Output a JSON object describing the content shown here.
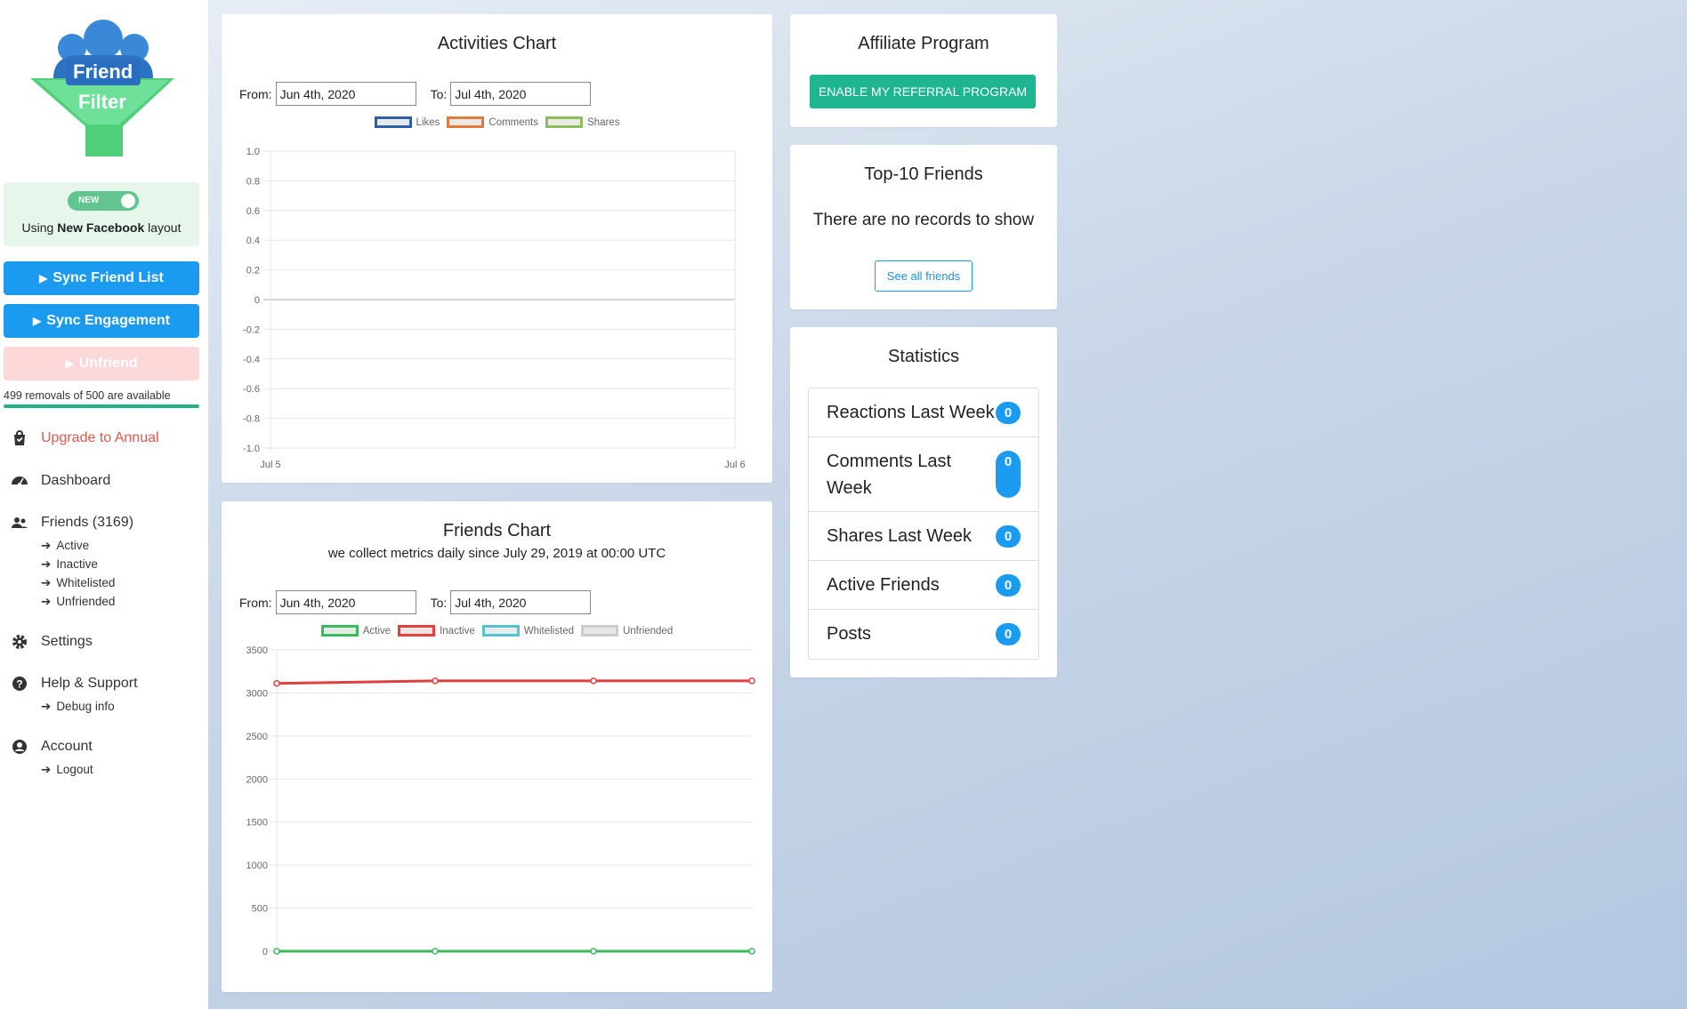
{
  "sidebar": {
    "logo": {
      "line1": "Friend",
      "line2": "Filter"
    },
    "layout": {
      "toggle_label": "NEW",
      "text_prefix": "Using ",
      "text_bold": "New Facebook",
      "text_suffix": " layout"
    },
    "buttons": [
      {
        "label": "Sync Friend List"
      },
      {
        "label": "Sync Engagement"
      },
      {
        "label": "Unfriend"
      }
    ],
    "removals_text": "499 removals of 500 are available",
    "removals_fraction": 0.998,
    "nav": {
      "upgrade": "Upgrade to Annual",
      "dashboard": "Dashboard",
      "friends": "Friends (3169)",
      "friends_sub": [
        "Active",
        "Inactive",
        "Whitelisted",
        "Unfriended"
      ],
      "settings": "Settings",
      "help": "Help & Support",
      "help_sub": [
        "Debug info"
      ],
      "account": "Account",
      "account_sub": [
        "Logout"
      ]
    },
    "arrow_glyph": "➔"
  },
  "activities": {
    "title": "Activities Chart",
    "from_label": "From:",
    "from_value": "Jun 4th, 2020",
    "to_label": "To:",
    "to_value": "Jul 4th, 2020"
  },
  "friends_chart": {
    "title": "Friends Chart",
    "subtitle": "we collect metrics daily since July 29, 2019 at 00:00 UTC",
    "from_label": "From:",
    "from_value": "Jun 4th, 2020",
    "to_label": "To:",
    "to_value": "Jul 4th, 2020"
  },
  "affiliate": {
    "title": "Affiliate Program",
    "button": "ENABLE MY REFERRAL PROGRAM"
  },
  "top10": {
    "title": "Top-10 Friends",
    "empty": "There are no records to show",
    "button": "See all friends"
  },
  "statistics": {
    "title": "Statistics",
    "rows": [
      {
        "label": "Reactions Last Week",
        "value": "0"
      },
      {
        "label": "Comments Last Week",
        "value": "0"
      },
      {
        "label": "Shares Last Week",
        "value": "0"
      },
      {
        "label": "Active Friends",
        "value": "0"
      },
      {
        "label": "Posts",
        "value": "0"
      }
    ]
  },
  "colors": {
    "primary": "#1a9bf0",
    "teal": "#1fb590",
    "upgrade": "#e2554f"
  },
  "chart_data": [
    {
      "type": "line",
      "title": "Activities Chart",
      "categories": [
        "Jul 5",
        "Jul 6"
      ],
      "series": [
        {
          "name": "Likes",
          "color": "#2d5fa8",
          "values": []
        },
        {
          "name": "Comments",
          "color": "#e07b39",
          "values": []
        },
        {
          "name": "Shares",
          "color": "#8cbf5a",
          "values": []
        }
      ],
      "ylim": [
        -1.0,
        1.0
      ],
      "yticks": [
        "1.0",
        "0.8",
        "0.6",
        "0.4",
        "0.2",
        "0",
        "-0.2",
        "-0.4",
        "-0.6",
        "-0.8",
        "-1.0"
      ],
      "grid": true,
      "legend": "top"
    },
    {
      "type": "line",
      "title": "Friends Chart",
      "x": [
        0,
        1,
        2,
        3
      ],
      "series": [
        {
          "name": "Active",
          "color": "#3cb95c",
          "values": [
            0,
            0,
            0,
            0
          ]
        },
        {
          "name": "Inactive",
          "color": "#e04040",
          "values": [
            3110,
            3140,
            3140,
            3140
          ]
        },
        {
          "name": "Whitelisted",
          "color": "#56c4cf",
          "values": []
        },
        {
          "name": "Unfriended",
          "color": "#cccccc",
          "values": []
        }
      ],
      "ylim": [
        0,
        3500
      ],
      "yticks": [
        "3500",
        "3000",
        "2500",
        "2000",
        "1500",
        "1000",
        "500",
        "0"
      ],
      "grid": true,
      "legend": "top"
    }
  ]
}
